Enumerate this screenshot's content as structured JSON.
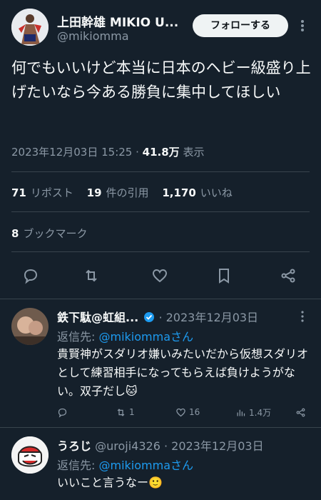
{
  "tweet": {
    "author_name": "上田幹雄 MIKIO U...",
    "author_handle": "@mikiomma",
    "follow_label": "フォローする",
    "text": "何でもいいけど本当に日本のヘビー級盛り上げたいなら今ある勝負に集中してほしい",
    "timestamp": "2023年12月03日 15:25 · ",
    "views": "41.8万",
    "views_label": " 表示",
    "reposts_count": "71",
    "reposts_label": "リポスト",
    "quotes_count": "19",
    "quotes_label": "件の引用",
    "likes_count": "1,170",
    "likes_label": "いいね",
    "bookmarks_count": "8",
    "bookmarks_label": "ブックマーク"
  },
  "actions": [
    "reply-icon",
    "repost-icon",
    "like-icon",
    "bookmark-icon",
    "share-icon"
  ],
  "replies": [
    {
      "name": "鉄下駄@虹組...",
      "verified": true,
      "date": " · 2023年12月03日",
      "reply_to_prefix": "返信先: ",
      "reply_to_handle": "@mikiommaさん",
      "text": "貴賢神がスダリオ嫌いみたいだから仮想スダリオとして練習相手になってもらえば負けようがない。双子だし🐱",
      "reposts": "1",
      "likes": "16",
      "views": "1.4万"
    },
    {
      "name": "うろじ",
      "handle": " @uroji4326",
      "date": " · 2023年12月03日",
      "reply_to_prefix": "返信先: ",
      "reply_to_handle": "@mikiommaさん",
      "text": "いいこと言うなー🙂"
    }
  ],
  "colors": {
    "background": "#15202b",
    "text": "#f7f9f9",
    "muted": "#8b98a5",
    "accent": "#1d9bf0",
    "divider": "#38444d"
  }
}
